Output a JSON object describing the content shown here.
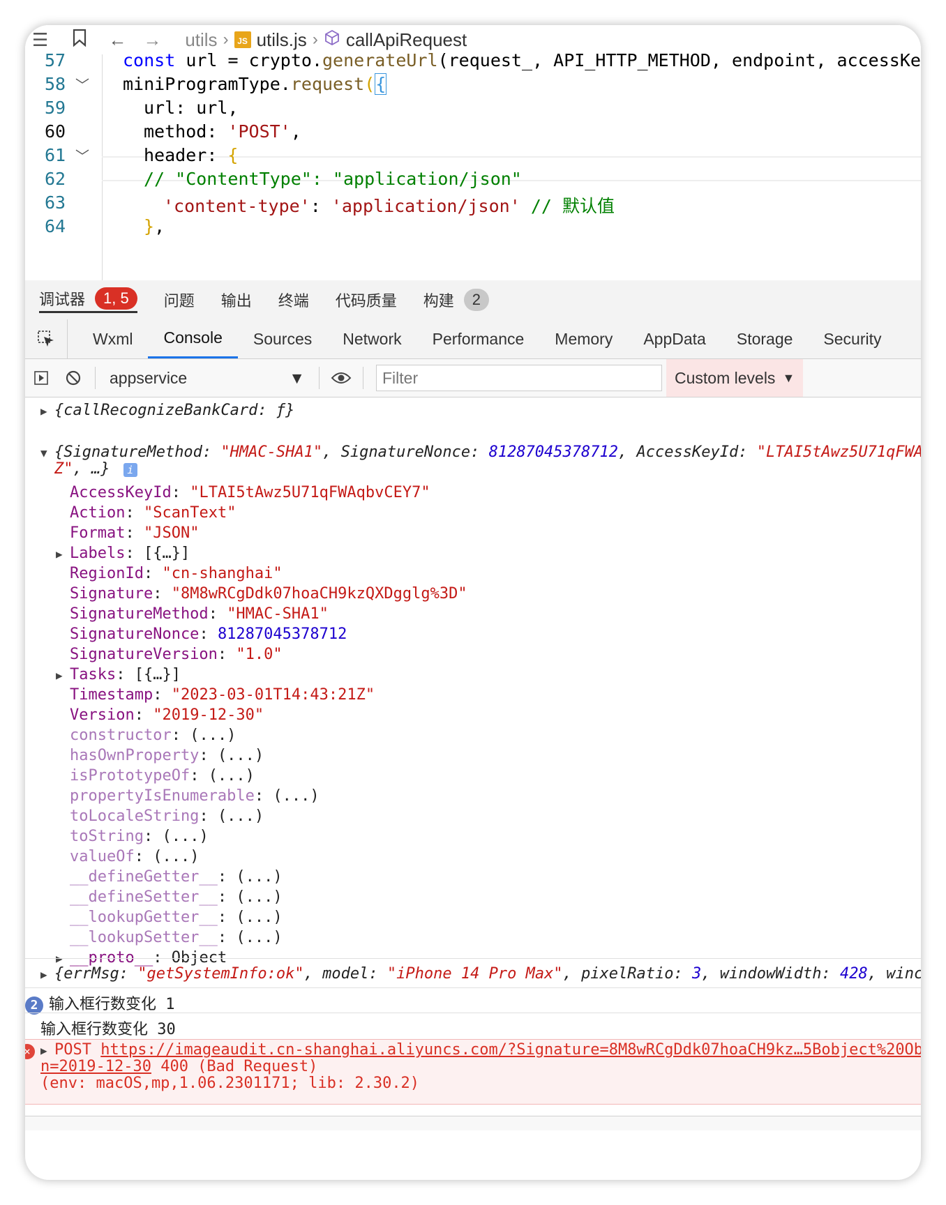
{
  "breadcrumb": {
    "folder": "utils",
    "file": "utils.js",
    "js_badge": "JS",
    "symbol": "callApiRequest"
  },
  "editor": {
    "lines": [
      {
        "num": "57",
        "code": [
          "const",
          " url = ",
          "crypto",
          ".",
          "generateUrl",
          "(request_, API_HTTP_METHOD, endpoint, accessKeySe"
        ]
      },
      {
        "num": "58",
        "code": [
          "miniProgramType",
          ".",
          "request",
          "(",
          "{"
        ]
      },
      {
        "num": "59",
        "code": [
          "url",
          ": url,"
        ]
      },
      {
        "num": "60",
        "code": [
          "method",
          ": ",
          "'POST'",
          ","
        ]
      },
      {
        "num": "61",
        "code": [
          "header",
          ": ",
          "{"
        ]
      },
      {
        "num": "62",
        "code": [
          "//   \"ContentType\": \"application/json\""
        ]
      },
      {
        "num": "63",
        "code": [
          "'content-type'",
          ": ",
          "'application/json'",
          " // 默认值"
        ]
      },
      {
        "num": "64",
        "code": [
          "}",
          ","
        ]
      }
    ]
  },
  "panel_tabs": {
    "debugger": "调试器",
    "debugger_badge": "1, 5",
    "issues": "问题",
    "output": "输出",
    "terminal": "终端",
    "code_quality": "代码质量",
    "build": "构建",
    "build_badge": "2"
  },
  "devtools_tabs": [
    "Wxml",
    "Console",
    "Sources",
    "Network",
    "Performance",
    "Memory",
    "AppData",
    "Storage",
    "Security"
  ],
  "console_toolbar": {
    "context": "appservice",
    "filter_placeholder": "Filter",
    "levels": "Custom levels"
  },
  "console": {
    "entry1": "{callRecognizeBankCard: ƒ}",
    "entry2_header": {
      "open": "{",
      "k1": "SignatureMethod",
      "v1": "\"HMAC-SHA1\"",
      "k2": "SignatureNonce",
      "v2": "81287045378712",
      "k3": "AccessKeyId",
      "v3": "\"LTAI5tAwz5U71qFWA",
      "wrap": "Z\"",
      "rest": ", …}"
    },
    "props": [
      {
        "k": "AccessKeyId",
        "v": "\"LTAI5tAwz5U71qFWAqbvCEY7\"",
        "t": "s"
      },
      {
        "k": "Action",
        "v": "\"ScanText\"",
        "t": "s"
      },
      {
        "k": "Format",
        "v": "\"JSON\"",
        "t": "s"
      },
      {
        "k": "Labels",
        "v": "[{…}]",
        "t": "o",
        "expand": true
      },
      {
        "k": "RegionId",
        "v": "\"cn-shanghai\"",
        "t": "s"
      },
      {
        "k": "Signature",
        "v": "\"8M8wRCgDdk07hoaCH9kzQXDgglg%3D\"",
        "t": "s"
      },
      {
        "k": "SignatureMethod",
        "v": "\"HMAC-SHA1\"",
        "t": "s"
      },
      {
        "k": "SignatureNonce",
        "v": "81287045378712",
        "t": "n"
      },
      {
        "k": "SignatureVersion",
        "v": "\"1.0\"",
        "t": "s"
      },
      {
        "k": "Tasks",
        "v": "[{…}]",
        "t": "o",
        "expand": true
      },
      {
        "k": "Timestamp",
        "v": "\"2023-03-01T14:43:21Z\"",
        "t": "s"
      },
      {
        "k": "Version",
        "v": "\"2019-12-30\"",
        "t": "s"
      },
      {
        "k": "constructor",
        "v": "(...)",
        "t": "d"
      },
      {
        "k": "hasOwnProperty",
        "v": "(...)",
        "t": "d"
      },
      {
        "k": "isPrototypeOf",
        "v": "(...)",
        "t": "d"
      },
      {
        "k": "propertyIsEnumerable",
        "v": "(...)",
        "t": "d"
      },
      {
        "k": "toLocaleString",
        "v": "(...)",
        "t": "d"
      },
      {
        "k": "toString",
        "v": "(...)",
        "t": "d"
      },
      {
        "k": "valueOf",
        "v": "(...)",
        "t": "d"
      },
      {
        "k": "__defineGetter__",
        "v": "(...)",
        "t": "d"
      },
      {
        "k": "__defineSetter__",
        "v": "(...)",
        "t": "d"
      },
      {
        "k": "__lookupGetter__",
        "v": "(...)",
        "t": "d"
      },
      {
        "k": "__lookupSetter__",
        "v": "(...)",
        "t": "d"
      },
      {
        "k": "__proto__",
        "v": "Object",
        "t": "o",
        "expand": true
      }
    ],
    "entry3": {
      "k1": "errMsg",
      "v1": "\"getSystemInfo:ok\"",
      "k2": "model",
      "v2": "\"iPhone 14 Pro Max\"",
      "k3": "pixelRatio",
      "v3": "3",
      "k4": "windowWidth",
      "v4": "428",
      "tail": "winc"
    },
    "log1_count": "2",
    "log1": "输入框行数变化  1",
    "log2": "输入框行数变化  30",
    "error": {
      "method": "POST",
      "url": "https://imageaudit.cn-shanghai.aliyuncs.com/?Signature=8M8wRCgDdk07hoaCH9kz…5Bobject%20Ob",
      "url2": "n=2019-12-30",
      "status": " 400 (Bad Request)",
      "env": "(env: macOS,mp,1.06.2301171; lib: 2.30.2)"
    }
  }
}
